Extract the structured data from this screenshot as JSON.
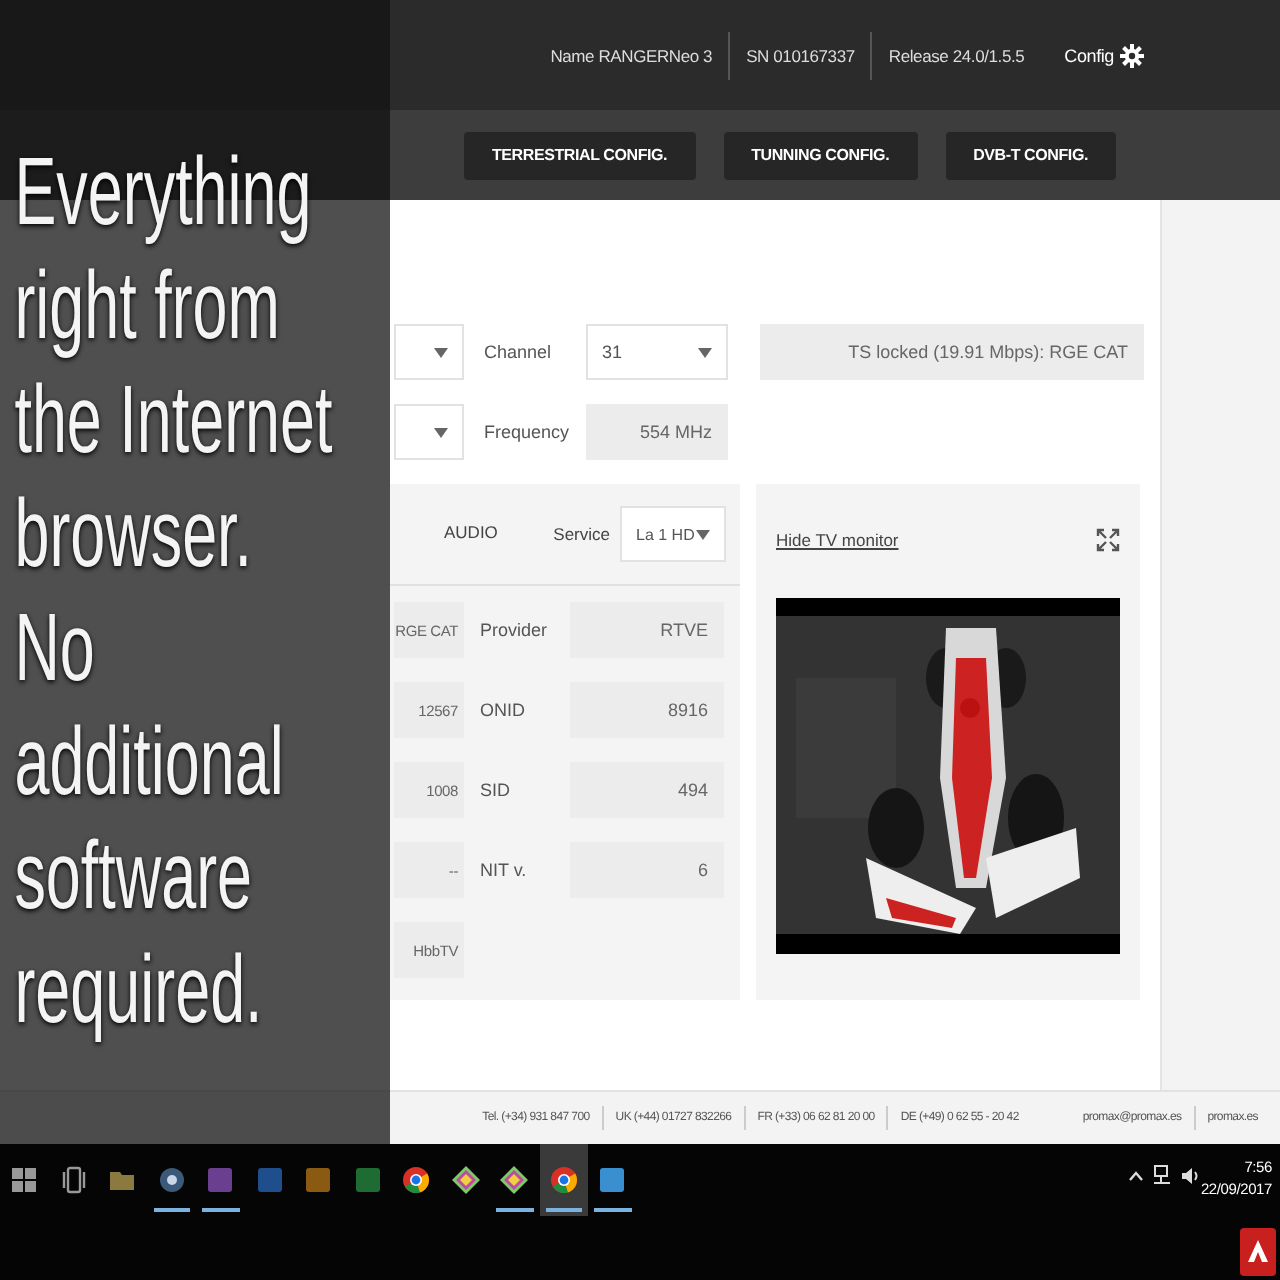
{
  "header": {
    "device_info": [
      "Name RANGERNeo 3",
      "SN 010167337",
      "Release 24.0/1.5.5"
    ],
    "config": "Config"
  },
  "config_buttons": [
    "TERRESTRIAL CONFIG.",
    "TUNNING CONFIG.",
    "DVB-T CONFIG."
  ],
  "caption": [
    "Everything right from the Internet browser.",
    "No additional software required."
  ],
  "tuning": {
    "channel_label": "Channel",
    "channel": "31",
    "frequency_label": "Frequency",
    "frequency": "554 MHz",
    "status": "TS locked (19.91 Mbps): RGE CAT"
  },
  "service_panel": {
    "tabs": [
      {
        "label": "AUDIO",
        "selected": false
      }
    ],
    "service_label": "Service",
    "service": "La 1 HD",
    "rows": [
      {
        "value": "RGE CAT",
        "pair": {
          "label": "Provider",
          "value": "RTVE"
        }
      },
      {
        "value": "12567",
        "pair": {
          "label": "ONID",
          "value": "8916"
        }
      },
      {
        "value": "1008",
        "pair": {
          "label": "SID",
          "value": "494"
        }
      },
      {
        "value": "--",
        "pair": {
          "label": "NIT v.",
          "value": "6"
        }
      },
      {
        "value": "HbbTV"
      }
    ]
  },
  "monitor": {
    "link": "Hide TV monitor"
  },
  "footer": {
    "contacts": [
      "Tel. (+34) 931 847 700",
      "UK (+44) 01727 832266",
      "FR (+33) 06 62 81 20 00",
      "DE (+49) 0 62 55 - 20 42"
    ],
    "links": [
      "promax@promax.es",
      "promax.es"
    ]
  },
  "taskbar": {
    "apps": [
      {
        "kind": "windows",
        "open": false,
        "selected": false
      },
      {
        "kind": "taskview",
        "open": false,
        "selected": false
      },
      {
        "kind": "folder",
        "open": false,
        "selected": false
      },
      {
        "kind": "globe",
        "open": true,
        "selected": false
      },
      {
        "kind": "tile",
        "color": "#6a3f8f",
        "open": true,
        "selected": false
      },
      {
        "kind": "tile",
        "color": "#1f4e8c",
        "open": false,
        "selected": false
      },
      {
        "kind": "tile",
        "color": "#8a5a12",
        "open": false,
        "selected": false
      },
      {
        "kind": "tile",
        "color": "#1e6b34",
        "open": false,
        "selected": false
      },
      {
        "kind": "browser",
        "open": false,
        "selected": false
      },
      {
        "kind": "diamond",
        "open": false,
        "selected": false
      },
      {
        "kind": "diamond",
        "open": true,
        "selected": false
      },
      {
        "kind": "browser",
        "open": true,
        "selected": true
      },
      {
        "kind": "tile",
        "color": "#3a8fd0",
        "open": true,
        "selected": false
      }
    ],
    "time": "7:56",
    "date": "22/09/2017"
  }
}
